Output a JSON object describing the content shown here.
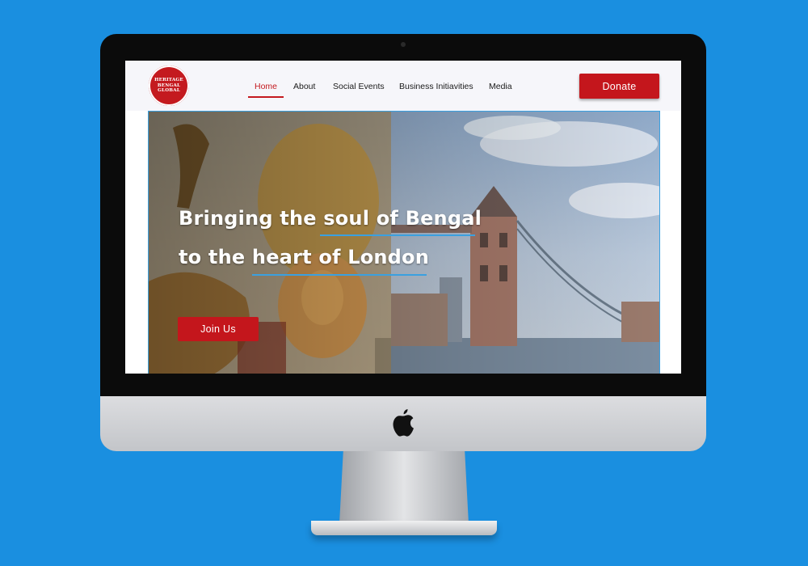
{
  "site": {
    "logo_text": [
      "HERITAGE",
      "BENGAL",
      "GLOBAL"
    ],
    "nav": [
      {
        "label": "Home",
        "active": true
      },
      {
        "label": "About"
      },
      {
        "label": "Social Events"
      },
      {
        "label": "Business Initiavities"
      },
      {
        "label": "Media"
      }
    ],
    "donate_label": "Donate"
  },
  "hero": {
    "line1": "Bringing the soul of Bengal",
    "line2": "to the heart of London",
    "join_label": "Join Us"
  },
  "colors": {
    "background": "#1a8fe0",
    "brand_red": "#c4161c",
    "accent_blue": "#3aa0e0",
    "header_bg": "#f6f6fa"
  },
  "icons": {
    "device_logo": "apple-logo-icon",
    "site_logo": "heritage-bengal-global-logo"
  }
}
